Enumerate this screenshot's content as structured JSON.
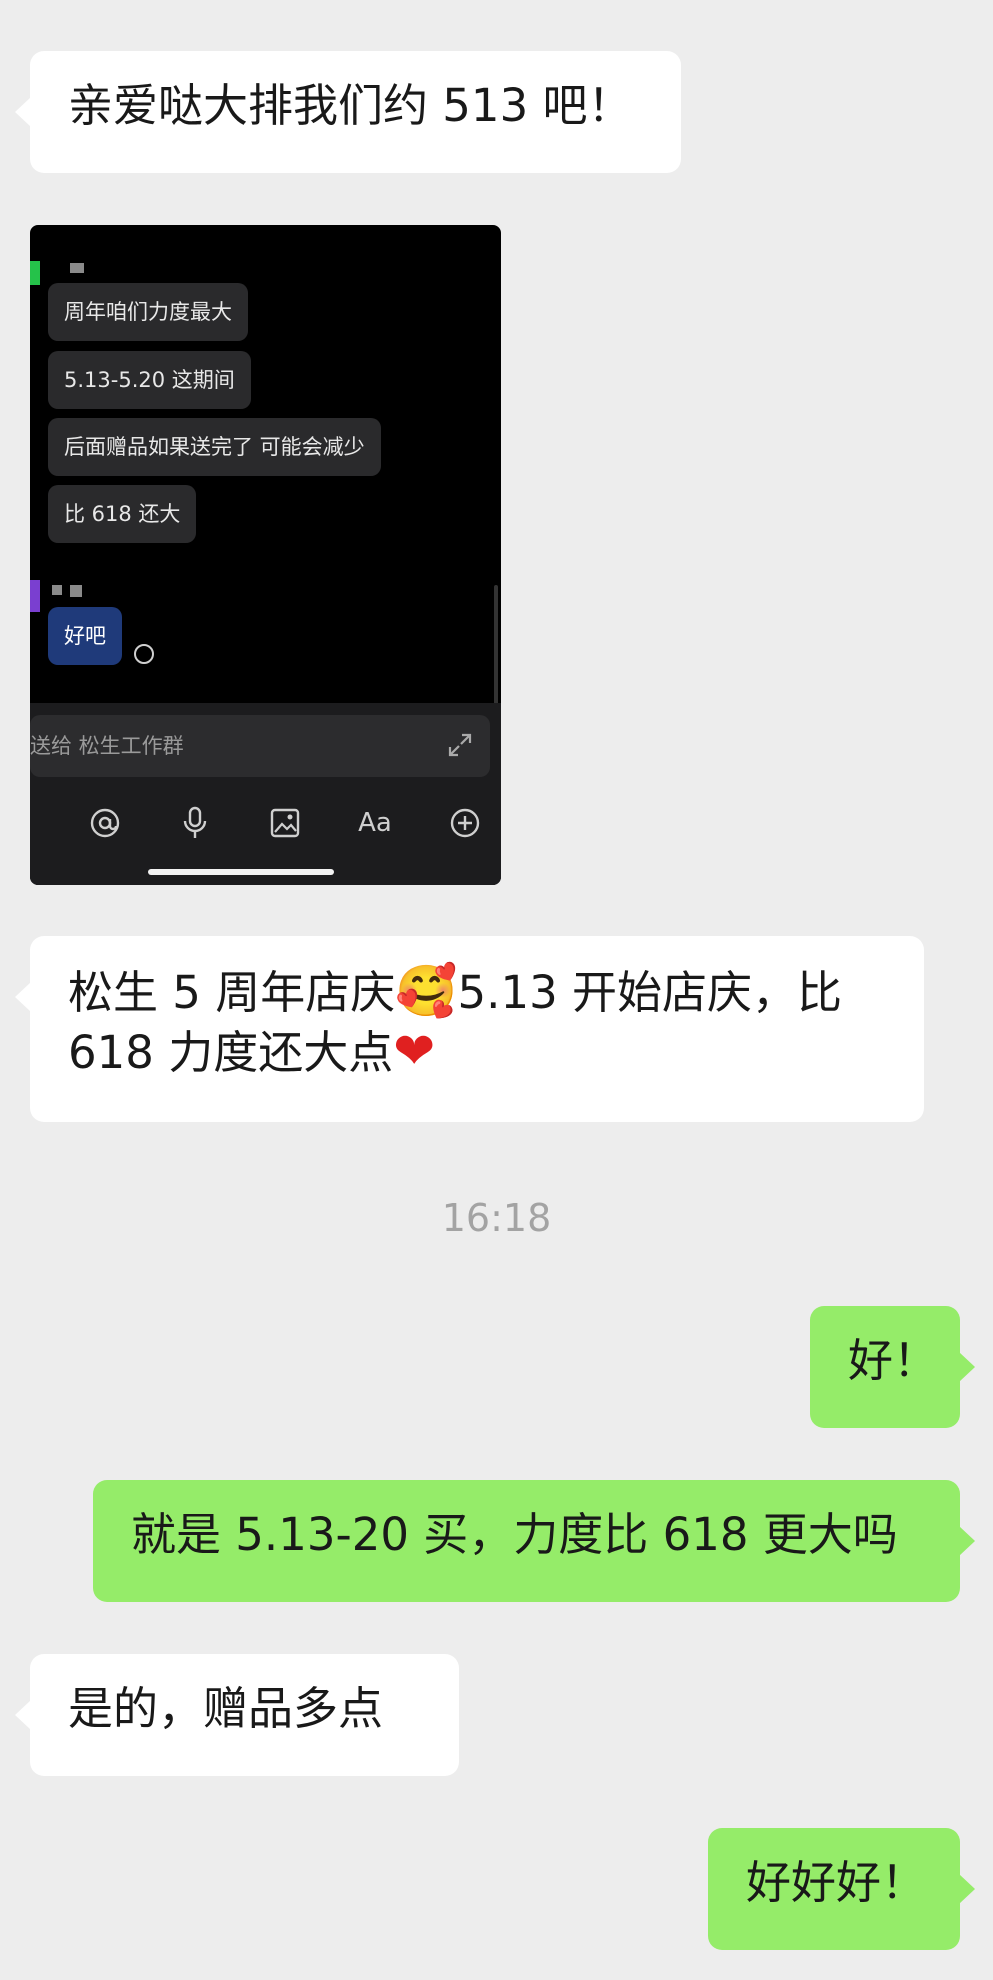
{
  "messages": {
    "m1": "亲爱哒大排我们约 513 吧！",
    "m2_line1_a": "松生 5 周年店庆",
    "m2_emoji": "🥰",
    "m2_line1_b": "5.13 开始店庆，比",
    "m2_line2": "618 力度还大点",
    "m2_heart": "❤",
    "timestamp": "16:18",
    "m3": "好！",
    "m4": "就是 5.13-20 买，力度比 618 更大吗",
    "m5": "是的，赠品多点",
    "m6": "好好好！"
  },
  "embedded_screenshot": {
    "msg1": "周年咱们力度最大",
    "msg2": "5.13-5.20 这期间",
    "msg3": "后面赠品如果送完了 可能会减少",
    "msg4": "比 618 还大",
    "reply": "好吧",
    "input_placeholder": "送给 松生工作群",
    "toolbar_aa": "Aa",
    "toolbar_icons": [
      "at-icon",
      "microphone-icon",
      "image-icon",
      "text-format-icon",
      "plus-circle-icon"
    ]
  },
  "colors": {
    "background": "#ededed",
    "incoming_bubble": "#ffffff",
    "outgoing_bubble": "#95ec69",
    "timestamp": "#a3a3a3"
  }
}
